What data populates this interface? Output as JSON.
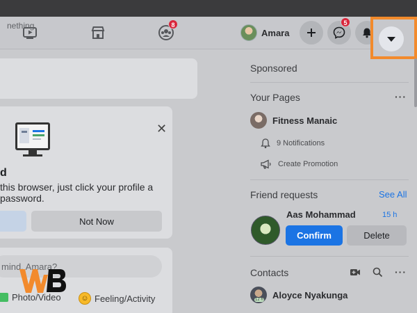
{
  "nav": {
    "groups_badge": "8",
    "messenger_badge": "5",
    "profile_name": "Amara"
  },
  "feed": {
    "status_placeholder": "nething.",
    "save_login_title": "d",
    "save_login_desc": "this browser, just click your profile a password.",
    "not_now_label": "Not Now",
    "composer_placeholder": "mind, Amara?",
    "photo_video_label": "Photo/Video",
    "feeling_label": "Feeling/Activity"
  },
  "sidebar": {
    "sponsored_title": "Sponsored",
    "your_pages_title": "Your Pages",
    "page_name": "Fitness Manaic",
    "notifications_label": "9 Notifications",
    "create_promotion_label": "Create Promotion",
    "friend_requests_title": "Friend requests",
    "see_all_label": "See All",
    "friend_name": "Aas Mohammad",
    "friend_time": "15 h",
    "confirm_label": "Confirm",
    "delete_label": "Delete",
    "contacts_title": "Contacts",
    "contact_name": "Aloyce Nyakunga",
    "contact_badge": "12 h"
  },
  "watermark": {
    "logo_text": "WB"
  },
  "colors": {
    "accent": "#1b74e4",
    "highlight": "#f28a2c",
    "badge": "#d9263b"
  }
}
